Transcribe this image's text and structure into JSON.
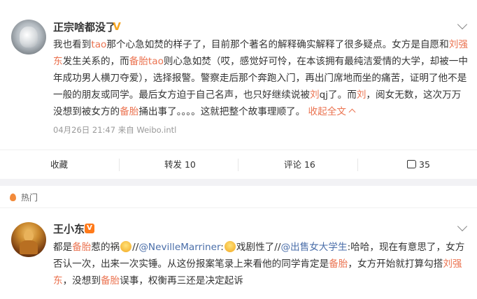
{
  "post1": {
    "username": "正宗啥都没了",
    "verified_badge": "V",
    "segments": [
      {
        "t": "我也看到",
        "c": ""
      },
      {
        "t": "tao",
        "c": "hl"
      },
      {
        "t": "那个心急如焚的样子了，目前那个著名的解释确实解释了很多疑点。女方是自愿和",
        "c": ""
      },
      {
        "t": "刘强东",
        "c": "hl"
      },
      {
        "t": "发生关系的，而",
        "c": ""
      },
      {
        "t": "备胎tao",
        "c": "hl"
      },
      {
        "t": "则心急如焚（哎，感觉好可怜，在本该拥有最纯洁爱情的大学，却被一中年成功男人横刀夺爱），选择报警。警察走后那个奔跑入门，再出门席地而坐的痛苦，证明了他不是一般的朋友或同学。最后女方迫于自己名声，也只好继续说被",
        "c": ""
      },
      {
        "t": "刘",
        "c": "hl"
      },
      {
        "t": "qj了。而",
        "c": ""
      },
      {
        "t": "刘",
        "c": "hl"
      },
      {
        "t": "，阅女无数，这次万万没想到被女方的",
        "c": ""
      },
      {
        "t": "备胎",
        "c": "hl"
      },
      {
        "t": "捅出事了。。。。这就把整个故事理顺了。 ",
        "c": ""
      }
    ],
    "collapse_label": "收起全文",
    "meta": "04月26日 21:47 来自 Weibo.intl"
  },
  "actions": {
    "collect": "收藏",
    "repost": "转发 10",
    "comment": "评论 16",
    "like": "35"
  },
  "hot_label": "热门",
  "post2": {
    "username": "王小东",
    "verified_badge": "V",
    "segments": [
      {
        "t": "都是",
        "c": ""
      },
      {
        "t": "备胎",
        "c": "hl"
      },
      {
        "t": "惹的祸",
        "c": ""
      },
      {
        "t": "[emoji]",
        "c": "emoji"
      },
      {
        "t": "//",
        "c": ""
      },
      {
        "t": "@NevilleMarriner",
        "c": "blue"
      },
      {
        "t": ":",
        "c": ""
      },
      {
        "t": "[emoji]",
        "c": "emoji"
      },
      {
        "t": "戏剧性了//",
        "c": ""
      },
      {
        "t": "@出售女大学生",
        "c": "blue"
      },
      {
        "t": ":哈哈，现在有意思了，女方否认一次，出来一次实锤。从这份报案笔录上来看他的同学肯定是",
        "c": ""
      },
      {
        "t": "备胎",
        "c": "hl"
      },
      {
        "t": "，女方开始就打算勾搭",
        "c": ""
      },
      {
        "t": "刘强东",
        "c": "hl"
      },
      {
        "t": "，没想到",
        "c": ""
      },
      {
        "t": "备胎",
        "c": "hl"
      },
      {
        "t": "误事，权衡再三还是决定起诉",
        "c": ""
      }
    ]
  }
}
